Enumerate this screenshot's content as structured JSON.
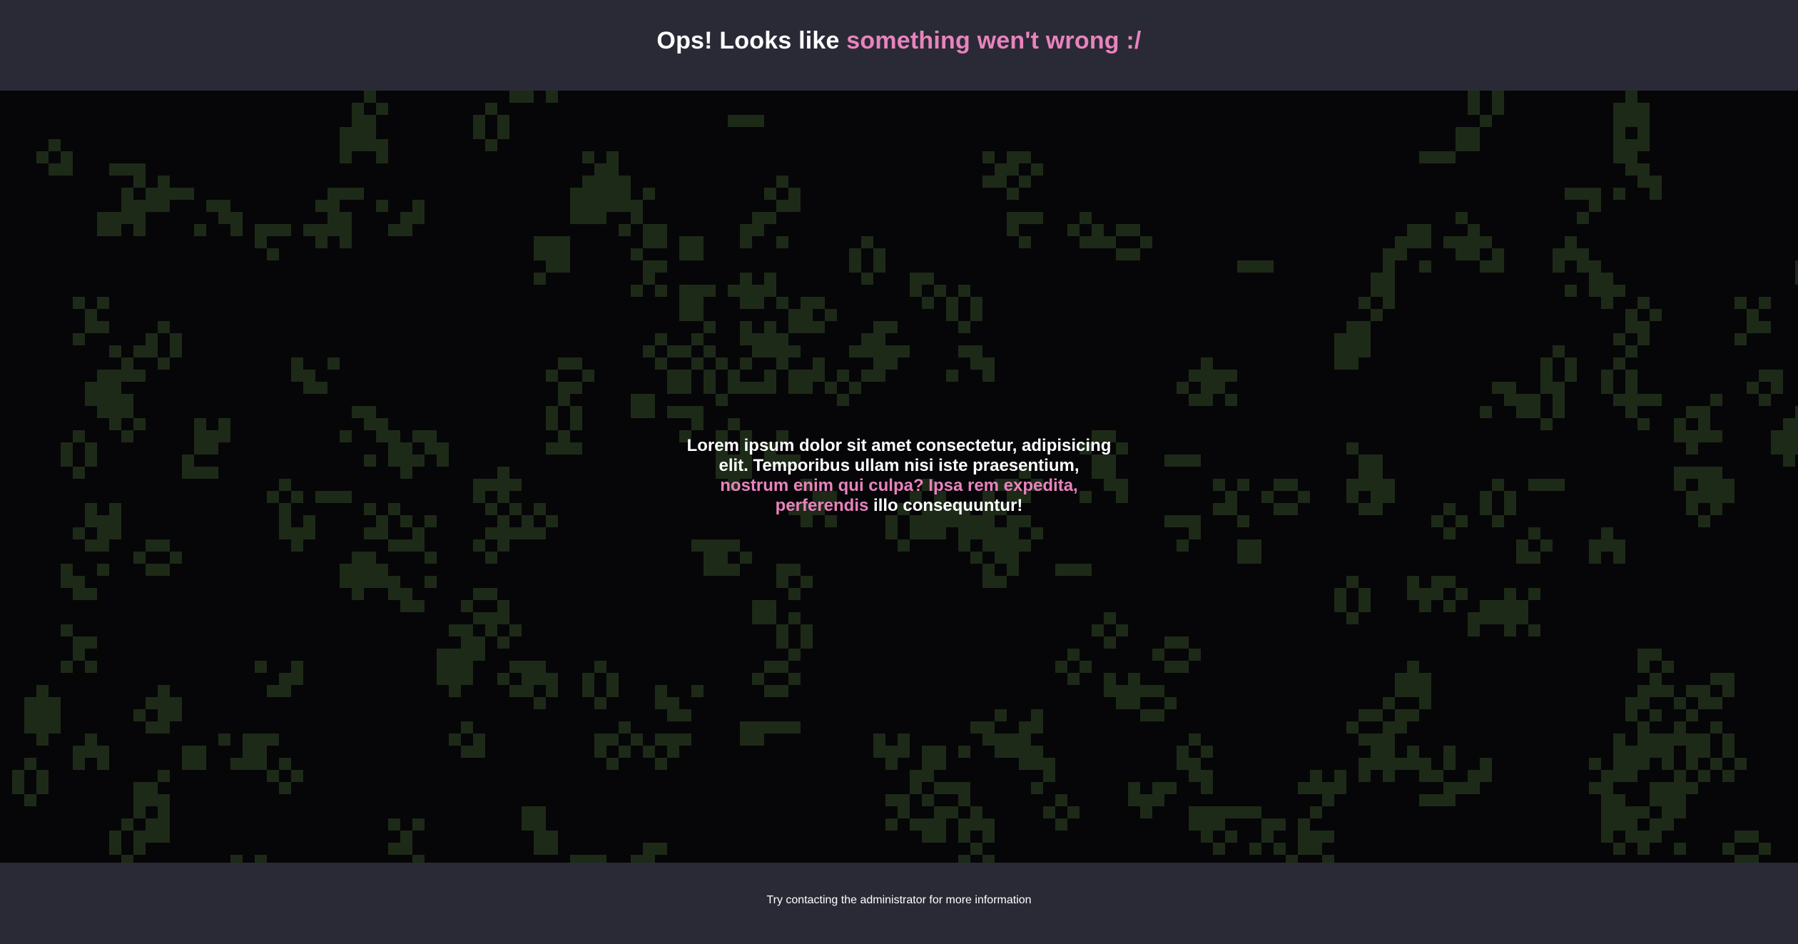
{
  "header": {
    "title_prefix": "Ops! Looks like ",
    "title_highlight": "something wen't wrong :/"
  },
  "message": {
    "part1": "Lorem ipsum dolor sit amet consectetur, adipisicing elit. Temporibus ullam nisi iste praesentium, ",
    "highlight": "nostrum enim qui culpa? Ipsa rem expedita, perferendis",
    "part2": " illo consequuntur!"
  },
  "footer": {
    "text": "Try contacting the administrator for more information"
  },
  "colors": {
    "background": "#060608",
    "bar": "#2a2a36",
    "accent": "#e883bd",
    "cell": "#1d2a18",
    "text": "#ffffff"
  }
}
